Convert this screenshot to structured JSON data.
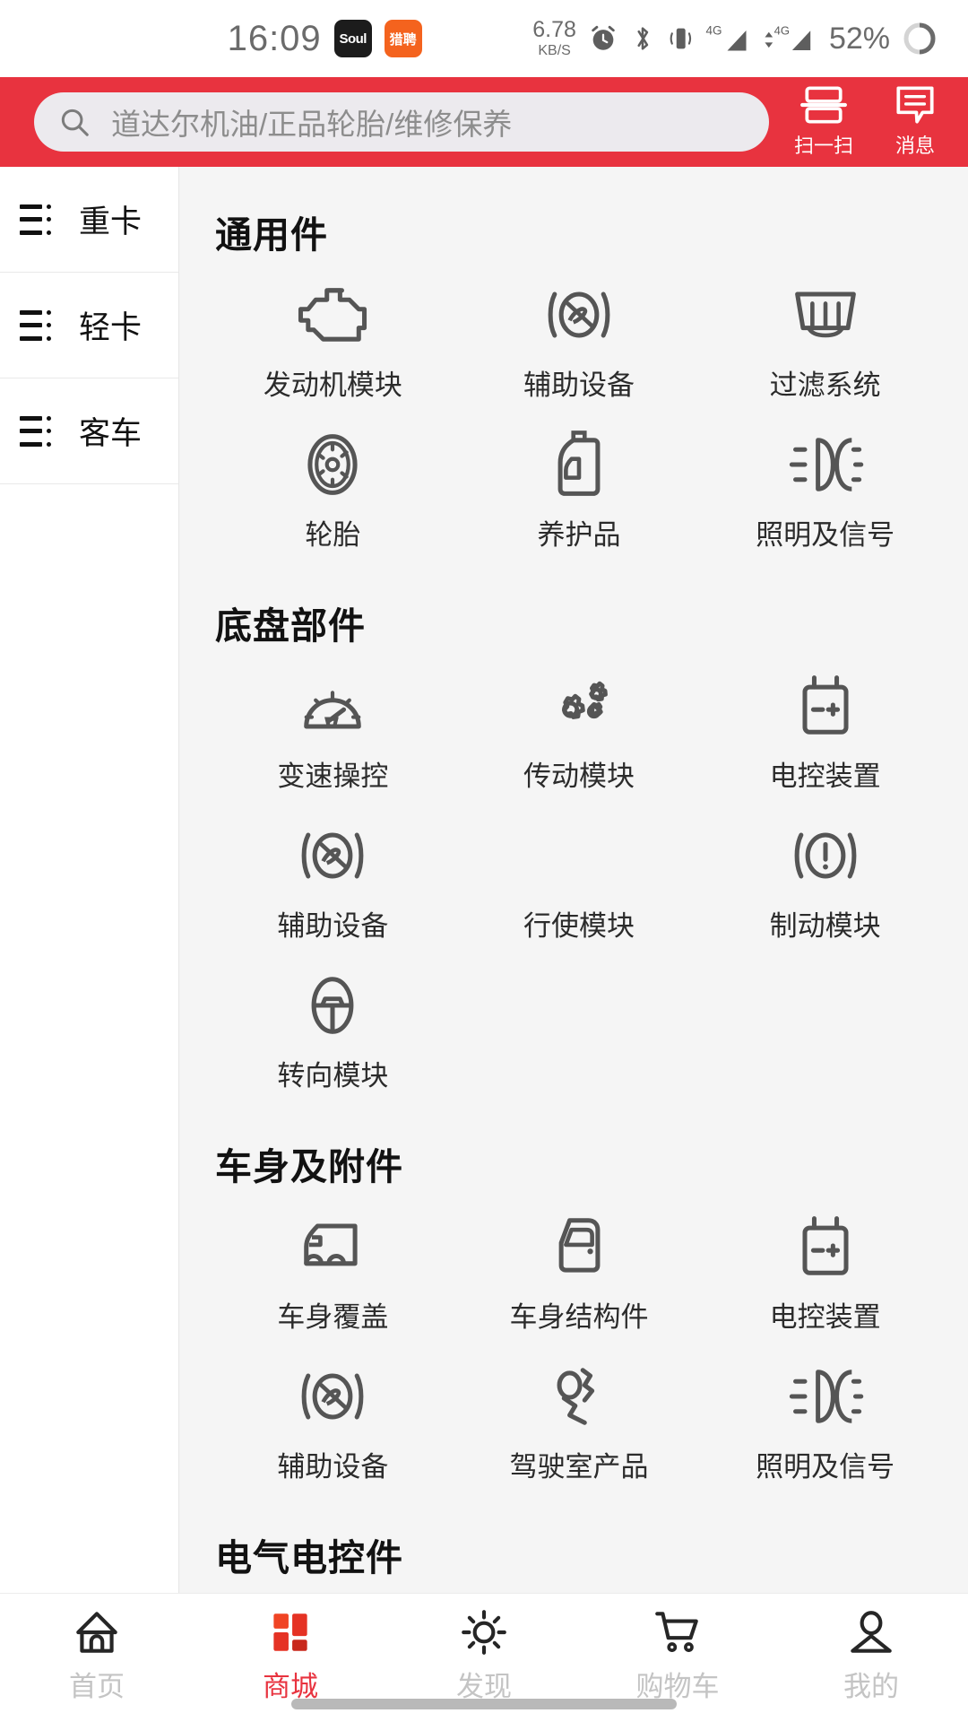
{
  "status_bar": {
    "time": "16:09",
    "notif_icons": [
      {
        "name": "soul-app-icon",
        "label": "Soul"
      },
      {
        "name": "liepin-app-icon",
        "label": "猎聘"
      }
    ],
    "network_speed_value": "6.78",
    "network_speed_unit": "KB/S",
    "indicators": [
      "alarm-icon",
      "bluetooth-icon",
      "vibrate-icon",
      "signal-4g-1-icon",
      "signal-4g-2-icon"
    ],
    "signal_label": "4G",
    "battery_percent": "52%"
  },
  "header": {
    "accent_color": "#E8333F",
    "search": {
      "placeholder": "道达尔机油/正品轮胎/维修保养",
      "value": "",
      "icon": "search-icon"
    },
    "actions": [
      {
        "name": "scan",
        "icon": "scan-icon",
        "label": "扫一扫"
      },
      {
        "name": "messages",
        "icon": "message-icon",
        "label": "消息"
      }
    ]
  },
  "sidebar": {
    "items": [
      {
        "label": "重卡",
        "icon": "list-icon",
        "active": false
      },
      {
        "label": "轻卡",
        "icon": "list-icon",
        "active": false
      },
      {
        "label": "客车",
        "icon": "list-icon",
        "active": false
      }
    ]
  },
  "content": {
    "sections": [
      {
        "title": "通用件",
        "items": [
          {
            "label": "发动机模块",
            "icon": "engine-icon"
          },
          {
            "label": "辅助设备",
            "icon": "auxiliary-icon"
          },
          {
            "label": "过滤系统",
            "icon": "filter-icon"
          },
          {
            "label": "轮胎",
            "icon": "tire-icon"
          },
          {
            "label": "养护品",
            "icon": "oil-bottle-icon"
          },
          {
            "label": "照明及信号",
            "icon": "headlight-icon"
          }
        ]
      },
      {
        "title": "底盘部件",
        "items": [
          {
            "label": "变速操控",
            "icon": "gauge-icon"
          },
          {
            "label": "传动模块",
            "icon": "gears-icon"
          },
          {
            "label": "电控装置",
            "icon": "battery-icon"
          },
          {
            "label": "辅助设备",
            "icon": "auxiliary-icon"
          },
          {
            "label": "行使模块",
            "icon": "none"
          },
          {
            "label": "制动模块",
            "icon": "brake-warning-icon"
          },
          {
            "label": "转向模块",
            "icon": "steering-wheel-icon"
          }
        ]
      },
      {
        "title": "车身及附件",
        "items": [
          {
            "label": "车身覆盖",
            "icon": "truck-body-icon"
          },
          {
            "label": "车身结构件",
            "icon": "car-door-icon"
          },
          {
            "label": "电控装置",
            "icon": "battery-icon"
          },
          {
            "label": "辅助设备",
            "icon": "auxiliary-icon"
          },
          {
            "label": "驾驶室产品",
            "icon": "seat-person-icon"
          },
          {
            "label": "照明及信号",
            "icon": "headlight-icon"
          }
        ]
      },
      {
        "title": "电气电控件",
        "items": []
      }
    ]
  },
  "tabbar": {
    "active_index": 1,
    "active_color": "#E8333F",
    "inactive_color": "#c4c4c4",
    "tabs": [
      {
        "label": "首页",
        "icon": "home-icon"
      },
      {
        "label": "商城",
        "icon": "store-grid-icon"
      },
      {
        "label": "发现",
        "icon": "discover-sun-icon"
      },
      {
        "label": "购物车",
        "icon": "cart-icon"
      },
      {
        "label": "我的",
        "icon": "profile-icon"
      }
    ]
  }
}
